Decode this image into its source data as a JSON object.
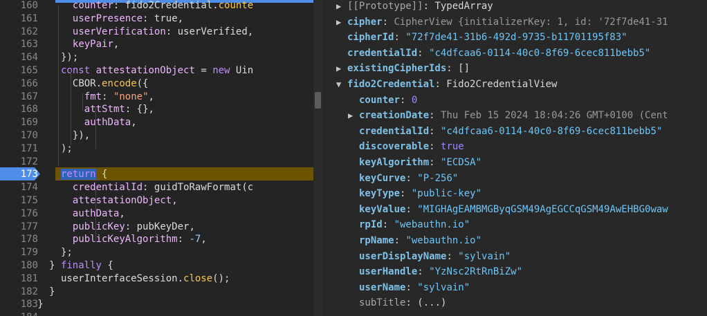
{
  "editor": {
    "lines": [
      {
        "n": "160",
        "indent": 4,
        "tokens": [
          [
            "prop",
            "counter"
          ],
          [
            "punc",
            ": fido2Credential."
          ],
          [
            "fn",
            "counte"
          ]
        ]
      },
      {
        "n": "161",
        "indent": 4,
        "tokens": [
          [
            "prop",
            "userPresence"
          ],
          [
            "punc",
            ": true,"
          ]
        ]
      },
      {
        "n": "162",
        "indent": 4,
        "tokens": [
          [
            "prop",
            "userVerification"
          ],
          [
            "punc",
            ": userVerified,"
          ]
        ]
      },
      {
        "n": "163",
        "indent": 4,
        "tokens": [
          [
            "prop",
            "keyPair"
          ],
          [
            "punc",
            ","
          ]
        ]
      },
      {
        "n": "164",
        "indent": 3,
        "tokens": [
          [
            "punc",
            "});"
          ]
        ]
      },
      {
        "n": "165",
        "indent": 3,
        "tokens": [
          [
            "kw",
            "const"
          ],
          [
            "punc",
            " "
          ],
          [
            "prop",
            "attestationObject"
          ],
          [
            "punc",
            " = "
          ],
          [
            "kw",
            "new"
          ],
          [
            "punc",
            " Uin"
          ]
        ]
      },
      {
        "n": "166",
        "indent": 4,
        "tokens": [
          [
            "punc",
            "CBOR."
          ],
          [
            "fn",
            "encode"
          ],
          [
            "punc",
            "({"
          ]
        ]
      },
      {
        "n": "167",
        "indent": 5,
        "tokens": [
          [
            "prop",
            "fmt"
          ],
          [
            "punc",
            ": "
          ],
          [
            "str",
            "\"none\""
          ],
          [
            "punc",
            ","
          ]
        ]
      },
      {
        "n": "168",
        "indent": 5,
        "tokens": [
          [
            "prop",
            "attStmt"
          ],
          [
            "punc",
            ": {},"
          ]
        ]
      },
      {
        "n": "169",
        "indent": 5,
        "tokens": [
          [
            "prop",
            "authData"
          ],
          [
            "punc",
            ","
          ]
        ]
      },
      {
        "n": "170",
        "indent": 4,
        "tokens": [
          [
            "punc",
            "}),"
          ]
        ]
      },
      {
        "n": "171",
        "indent": 3,
        "tokens": [
          [
            "punc",
            ");"
          ]
        ]
      },
      {
        "n": "172",
        "indent": 0,
        "tokens": []
      },
      {
        "n": "173",
        "indent": 3,
        "active": true,
        "tokens": [
          [
            "kwsel",
            "return"
          ],
          [
            "punc",
            " {"
          ]
        ]
      },
      {
        "n": "174",
        "indent": 4,
        "tokens": [
          [
            "prop",
            "credentialId"
          ],
          [
            "punc",
            ": guidToRawFormat(c"
          ]
        ]
      },
      {
        "n": "175",
        "indent": 4,
        "tokens": [
          [
            "prop",
            "attestationObject"
          ],
          [
            "punc",
            ","
          ]
        ]
      },
      {
        "n": "176",
        "indent": 4,
        "tokens": [
          [
            "prop",
            "authData"
          ],
          [
            "punc",
            ","
          ]
        ]
      },
      {
        "n": "177",
        "indent": 4,
        "tokens": [
          [
            "prop",
            "publicKey"
          ],
          [
            "punc",
            ": pubKeyDer,"
          ]
        ]
      },
      {
        "n": "178",
        "indent": 4,
        "tokens": [
          [
            "prop",
            "publicKeyAlgorithm"
          ],
          [
            "punc",
            ": "
          ],
          [
            "num",
            "-7"
          ],
          [
            "punc",
            ","
          ]
        ]
      },
      {
        "n": "179",
        "indent": 3,
        "tokens": [
          [
            "punc",
            "};"
          ]
        ]
      },
      {
        "n": "180",
        "indent": 2,
        "tokens": [
          [
            "punc",
            "} "
          ],
          [
            "kw",
            "finally"
          ],
          [
            "punc",
            " {"
          ]
        ]
      },
      {
        "n": "181",
        "indent": 3,
        "tokens": [
          [
            "punc",
            "userInterfaceSession."
          ],
          [
            "fn",
            "close"
          ],
          [
            "punc",
            "();"
          ]
        ]
      },
      {
        "n": "182",
        "indent": 2,
        "tokens": [
          [
            "punc",
            "}"
          ]
        ]
      },
      {
        "n": "183",
        "indent": 1,
        "tokens": [
          [
            "punc",
            "}"
          ]
        ]
      },
      {
        "n": "184",
        "indent": 0,
        "tokens": []
      }
    ]
  },
  "devtools": {
    "rows": [
      {
        "indent": 0,
        "tri": "▶",
        "key": "[[Prototype]]",
        "dimkey": true,
        "sep": ": ",
        "val": "TypedArray",
        "vcls": "plain"
      },
      {
        "indent": 0,
        "tri": "▶",
        "key": "cipher",
        "sep": ": ",
        "val": "CipherView {initializerKey: 1, id: '72f7de41-31",
        "vcls": "dgray"
      },
      {
        "indent": 0,
        "tri": "",
        "key": "cipherId",
        "sep": ": ",
        "val": "\"72f7de41-31b6-492d-9735-b11701195f83\"",
        "vcls": "dstr"
      },
      {
        "indent": 0,
        "tri": "",
        "key": "credentialId",
        "sep": ": ",
        "val": "\"c4dfcaa6-0114-40c0-8f69-6cec811bebb5\"",
        "vcls": "dstr"
      },
      {
        "indent": 0,
        "tri": "▶",
        "key": "existingCipherIds",
        "sep": ": ",
        "val": "[]",
        "vcls": "plain"
      },
      {
        "indent": 0,
        "tri": "▼",
        "key": "fido2Credential",
        "sep": ": ",
        "val": "Fido2CredentialView",
        "vcls": "plain"
      },
      {
        "indent": 1,
        "tri": "",
        "key": "counter",
        "sep": ": ",
        "val": "0",
        "vcls": "dnum"
      },
      {
        "indent": 1,
        "tri": "▶",
        "key": "creationDate",
        "sep": ": ",
        "val": "Thu Feb 15 2024 18:04:26 GMT+0100 (Cent",
        "vcls": "dgray"
      },
      {
        "indent": 1,
        "tri": "",
        "key": "credentialId",
        "sep": ": ",
        "val": "\"c4dfcaa6-0114-40c0-8f69-6cec811bebb5\"",
        "vcls": "dstr"
      },
      {
        "indent": 1,
        "tri": "",
        "key": "discoverable",
        "sep": ": ",
        "val": "true",
        "vcls": "dbool"
      },
      {
        "indent": 1,
        "tri": "",
        "key": "keyAlgorithm",
        "sep": ": ",
        "val": "\"ECDSA\"",
        "vcls": "dstr"
      },
      {
        "indent": 1,
        "tri": "",
        "key": "keyCurve",
        "sep": ": ",
        "val": "\"P-256\"",
        "vcls": "dstr"
      },
      {
        "indent": 1,
        "tri": "",
        "key": "keyType",
        "sep": ": ",
        "val": "\"public-key\"",
        "vcls": "dstr"
      },
      {
        "indent": 1,
        "tri": "",
        "key": "keyValue",
        "sep": ": ",
        "val": "\"MIGHAgEAMBMGByqGSM49AgEGCCqGSM49AwEHBG0waw",
        "vcls": "dstr"
      },
      {
        "indent": 1,
        "tri": "",
        "key": "rpId",
        "sep": ": ",
        "val": "\"webauthn.io\"",
        "vcls": "dstr"
      },
      {
        "indent": 1,
        "tri": "",
        "key": "rpName",
        "sep": ": ",
        "val": "\"webauthn.io\"",
        "vcls": "dstr"
      },
      {
        "indent": 1,
        "tri": "",
        "key": "userDisplayName",
        "sep": ": ",
        "val": "\"sylvain\"",
        "vcls": "dstr"
      },
      {
        "indent": 1,
        "tri": "",
        "key": "userHandle",
        "sep": ": ",
        "val": "\"YzNsc2RtRnBiZw\"",
        "vcls": "dstr"
      },
      {
        "indent": 1,
        "tri": "",
        "key": "userName",
        "sep": ": ",
        "val": "\"sylvain\"",
        "vcls": "dstr"
      },
      {
        "indent": 1,
        "tri": "",
        "key": "subTitle",
        "dimkey": true,
        "sep": ": ",
        "val": "(...)",
        "vcls": "plain"
      }
    ]
  }
}
